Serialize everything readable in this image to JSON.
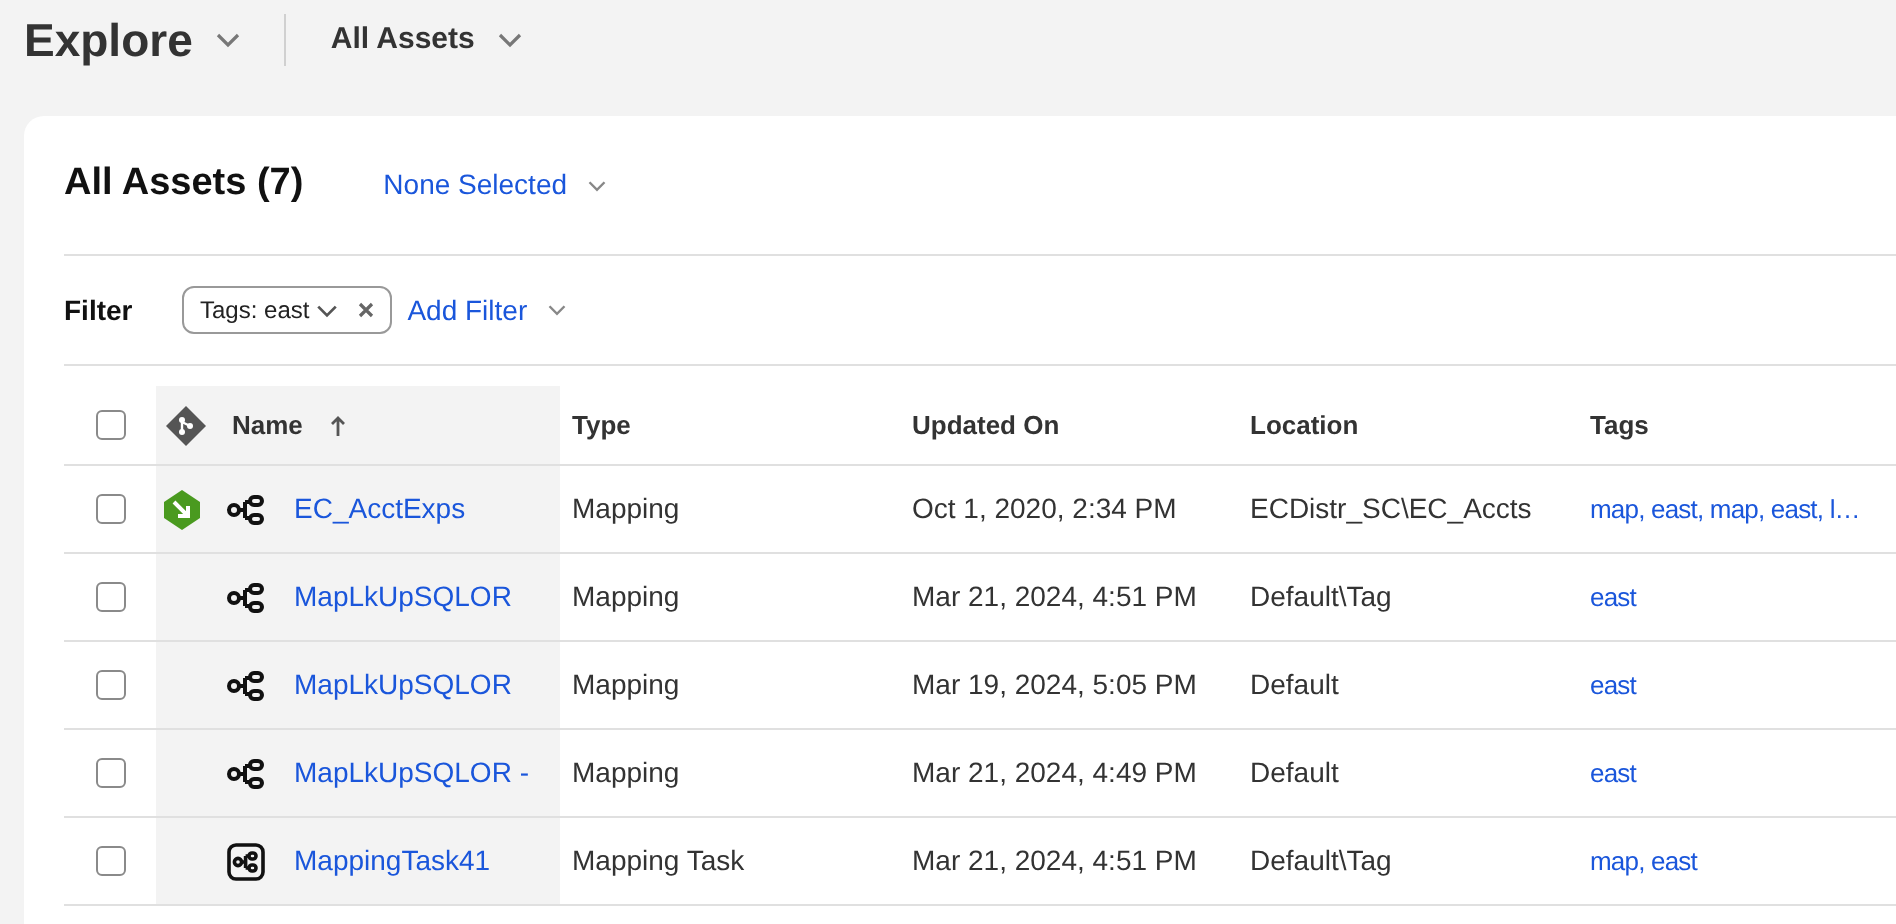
{
  "header": {
    "title": "Explore",
    "view": "All Assets"
  },
  "panel": {
    "title": "All Assets (7)",
    "selection": "None Selected"
  },
  "filter": {
    "label": "Filter",
    "chips": [
      {
        "label": "Tags: east"
      }
    ],
    "add_label": "Add Filter"
  },
  "table": {
    "select_all": false,
    "columns": [
      {
        "label": "Name",
        "sorted": true
      },
      {
        "label": "Type",
        "sorted": false
      },
      {
        "label": "Updated On",
        "sorted": false
      },
      {
        "label": "Location",
        "sorted": false
      },
      {
        "label": "Tags",
        "sorted": false
      }
    ],
    "rows": [
      {
        "checked": false,
        "checked_out": true,
        "kind": "mapping",
        "name": "EC_AcctExps",
        "type": "Mapping",
        "updated": "Oct 1, 2020, 2:34 PM",
        "location": "ECDistr_SC\\EC_Accts",
        "tags": "map, east, map, east, l…"
      },
      {
        "checked": false,
        "checked_out": false,
        "kind": "mapping",
        "name": "MapLkUpSQLOR",
        "type": "Mapping",
        "updated": "Mar 21, 2024, 4:51 PM",
        "location": "Default\\Tag",
        "tags": "east"
      },
      {
        "checked": false,
        "checked_out": false,
        "kind": "mapping",
        "name": "MapLkUpSQLOR",
        "type": "Mapping",
        "updated": "Mar 19, 2024, 5:05 PM",
        "location": "Default",
        "tags": "east"
      },
      {
        "checked": false,
        "checked_out": false,
        "kind": "mapping",
        "name": "MapLkUpSQLOR -",
        "type": "Mapping",
        "updated": "Mar 21, 2024, 4:49 PM",
        "location": "Default",
        "tags": "east"
      },
      {
        "checked": false,
        "checked_out": false,
        "kind": "task",
        "name": "MappingTask41",
        "type": "Mapping Task",
        "updated": "Mar 21, 2024, 4:51 PM",
        "location": "Default\\Tag",
        "tags": "map, east"
      }
    ]
  }
}
